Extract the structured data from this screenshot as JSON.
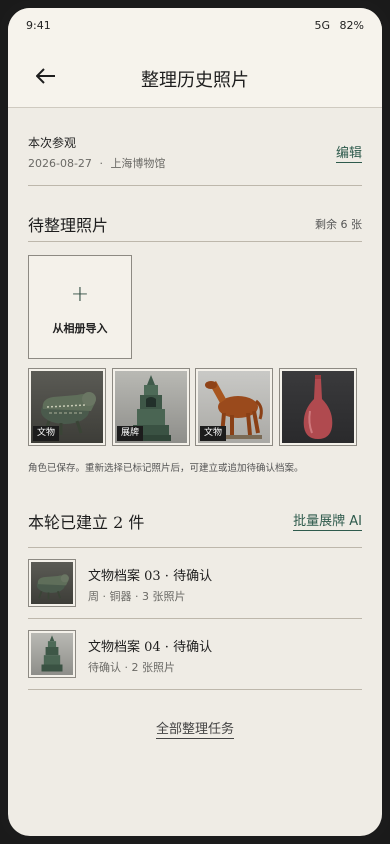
{
  "status_bar": {
    "time": "9:41",
    "network": "5G",
    "battery": "82%"
  },
  "header": {
    "title": "整理历史照片"
  },
  "visit": {
    "label": "本次参观",
    "date": "2026-08-27",
    "separator": "·",
    "venue": "上海博物馆",
    "edit_label": "编辑"
  },
  "pending": {
    "title": "待整理照片",
    "remaining": "剩余 6 张",
    "import_plus": "+",
    "import_label": "从相册导入"
  },
  "thumbnails": [
    {
      "tag": "文物",
      "subject": "bronze-vessel"
    },
    {
      "tag": "展牌",
      "subject": "stone-stupa"
    },
    {
      "tag": "文物",
      "subject": "tang-horse"
    },
    {
      "tag": "",
      "subject": "red-vase"
    }
  ],
  "note": "角色已保存。重新选择已标记照片后，可建立或追加待确认档案。",
  "built": {
    "title": "本轮已建立 2 件",
    "batch_label": "批量展牌 AI"
  },
  "records": [
    {
      "title": "文物档案 03 · 待确认",
      "meta": "周 · 铜器 · 3 张照片"
    },
    {
      "title": "文物档案 04 · 待确认",
      "meta": "待确认 · 2 张照片"
    }
  ],
  "all_tasks_label": "全部整理任务",
  "colors": {
    "accent": "#2e5a4c",
    "background": "#efece5",
    "tag_bg": "#1c1c1c"
  }
}
